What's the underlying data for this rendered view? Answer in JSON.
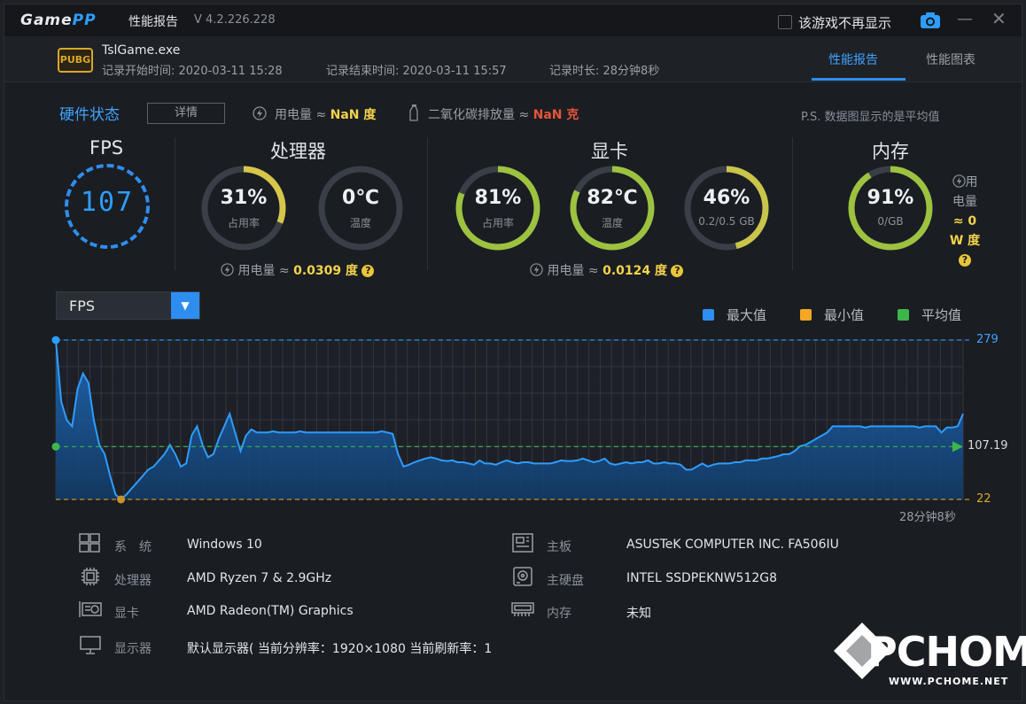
{
  "titlebar": {
    "logo_game": "Game",
    "logo_pp": "PP",
    "title": "性能报告",
    "version": "V 4.2.226.228",
    "no_more_label": "该游戏不再显示",
    "minimize": "—",
    "close": "✕"
  },
  "session": {
    "badge": "PUBG",
    "exe": "TslGame.exe",
    "start": "记录开始时间: 2020-03-11 15:28",
    "end": "记录结束时间: 2020-03-11 15:57",
    "duration": "记录时长: 28分钟8秒"
  },
  "tabs": [
    {
      "label": "性能报告",
      "active": true
    },
    {
      "label": "性能图表",
      "active": false
    }
  ],
  "hardware": {
    "title": "硬件状态",
    "detail_btn": "详情",
    "power_label": "用电量 ≈ ",
    "power_value": "NaN 度",
    "co2_label": "二氧化碳排放量 ≈ ",
    "co2_value": "NaN 克",
    "ps_note": "P.S. 数据图显示的是平均值"
  },
  "fps": {
    "title": "FPS",
    "value": "107",
    "color": "#2e8ef0"
  },
  "cpu": {
    "title": "处理器",
    "usage": {
      "value": "31%",
      "label": "占用率",
      "fraction": 0.31,
      "color": "#d6c64a"
    },
    "temp": {
      "value": "0℃",
      "label": "温度",
      "fraction": 0,
      "color": "#8bc34a"
    },
    "power_label": "用电量 ≈ ",
    "power_value": "0.0309 度"
  },
  "gpu": {
    "title": "显卡",
    "usage": {
      "value": "81%",
      "label": "占用率",
      "fraction": 0.81,
      "color": "#9cc240"
    },
    "temp": {
      "value": "82℃",
      "label": "温度",
      "fraction": 0.82,
      "color": "#9cc240"
    },
    "vram": {
      "value": "46%",
      "label": "0.2/0.5 GB",
      "fraction": 0.46,
      "color": "#c9c44a"
    },
    "power_label": "用电量 ≈ ",
    "power_value": "0.0124 度"
  },
  "memory": {
    "title": "内存",
    "usage": {
      "value": "91%",
      "label": "0/GB",
      "fraction": 0.91,
      "color": "#9cc240"
    },
    "power_line1": "用",
    "power_line2": "电量",
    "power_line3": "≈ 0",
    "power_line4": "W 度"
  },
  "qmark": "?",
  "metric_select": {
    "value": "FPS"
  },
  "legend": [
    {
      "label": "最大值",
      "color": "#2e8ef0"
    },
    {
      "label": "最小值",
      "color": "#f5a623"
    },
    {
      "label": "平均值",
      "color": "#3cb64a"
    }
  ],
  "chart_data": {
    "type": "area",
    "metric": "FPS",
    "max": 279,
    "min": 22,
    "avg": 107.19,
    "max_label": "279",
    "min_label": "22",
    "avg_label": "107.19",
    "duration_label": "28分钟8秒",
    "ylim": [
      22,
      279
    ],
    "values": [
      279,
      180,
      150,
      140,
      200,
      225,
      210,
      150,
      110,
      95,
      60,
      30,
      22,
      30,
      40,
      50,
      60,
      70,
      75,
      85,
      95,
      110,
      95,
      75,
      80,
      125,
      140,
      110,
      90,
      95,
      120,
      140,
      160,
      130,
      100,
      125,
      135,
      130,
      130,
      130,
      132,
      130,
      130,
      130,
      130,
      132,
      130,
      130,
      130,
      130,
      130,
      130,
      130,
      130,
      130,
      130,
      130,
      130,
      130,
      130,
      132,
      130,
      128,
      95,
      75,
      78,
      82,
      85,
      88,
      90,
      88,
      85,
      84,
      85,
      82,
      82,
      80,
      78,
      85,
      80,
      80,
      78,
      82,
      85,
      82,
      80,
      82,
      82,
      80,
      80,
      80,
      80,
      82,
      85,
      84,
      84,
      85,
      88,
      85,
      82,
      84,
      88,
      80,
      78,
      80,
      82,
      80,
      82,
      82,
      85,
      80,
      80,
      82,
      80,
      80,
      78,
      70,
      70,
      75,
      80,
      75,
      78,
      80,
      80,
      80,
      82,
      82,
      85,
      85,
      85,
      88,
      88,
      90,
      92,
      95,
      95,
      100,
      108,
      110,
      115,
      120,
      125,
      130,
      140,
      140,
      140,
      140,
      140,
      140,
      138,
      140,
      140,
      140,
      140,
      140,
      140,
      140,
      140,
      140,
      138,
      140,
      140,
      140,
      130,
      138,
      138,
      140,
      160
    ]
  },
  "sysinfo": {
    "os_k": "系　统",
    "os_v": "Windows 10",
    "cpu_k": "处理器",
    "cpu_v": "AMD Ryzen 7 & 2.9GHz",
    "gpu_k": "显卡",
    "gpu_v": "AMD Radeon(TM) Graphics",
    "display_k": "显示器",
    "display_v": "默认显示器( 当前分辨率：1920×1080 当前刷新率：1",
    "board_k": "主板",
    "board_v": "ASUSTeK COMPUTER INC. FA506IU",
    "disk_k": "主硬盘",
    "disk_v": "INTEL SSDPEKNW512G8",
    "mem_k": "内存",
    "mem_v": "未知"
  },
  "watermark": {
    "text": "PCHOME",
    "url": "WWW.PCHOME.NET"
  }
}
